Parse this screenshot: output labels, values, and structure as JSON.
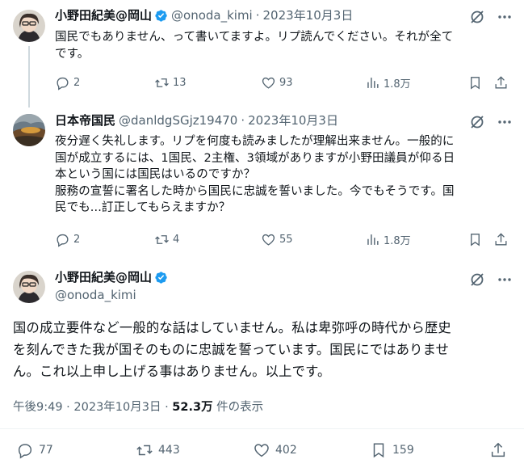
{
  "tweets": [
    {
      "name": "小野田紀美@岡山",
      "handle": "@onoda_kimi",
      "sep": "·",
      "date": "2023年10月3日",
      "text_lines": [
        "国民でもありません、って書いてますよ。リプ読んでください。それが全て",
        "です。"
      ],
      "replies": "2",
      "retweets": "13",
      "likes": "93",
      "views": "1.8万"
    },
    {
      "name": "日本帝国民",
      "handle": "@danldgSGjz19470",
      "sep": "·",
      "date": "2023年10月3日",
      "text_lines": [
        "夜分遅く失礼します。リプを何度も読みましたが理解出来ません。一般的に",
        "国が成立するには、1国民、2主権、3領域がありますが小野田議員が仰る日",
        "本という国には国民はいるのですか？",
        "服務の宣誓に署名した時から国民に忠誠を誓いました。今でもそうです。国",
        "民でも...訂正してもらえますか？"
      ],
      "replies": "2",
      "retweets": "4",
      "likes": "55",
      "views": "1.8万"
    }
  ],
  "main": {
    "name": "小野田紀美@岡山",
    "handle": "@onoda_kimi",
    "text_lines": [
      "国の成立要件など一般的な話はしていません。私は卑弥呼の時代から歴史",
      "を刻んできた我が国そのものに忠誠を誓っています。国民にではありませ",
      "ん。これ以上申し上げる事はありません。以上です。"
    ],
    "time": "午後9:49 · 2023年10月3日 · ",
    "views": "52.3万",
    "views_label": " 件の表示",
    "replies": "77",
    "retweets": "443",
    "likes": "402",
    "bookmarks": "159"
  },
  "colors": {
    "text": "#0f1419",
    "muted": "#536471",
    "verified": "#1d9bf0",
    "line": "#cfd9de"
  }
}
